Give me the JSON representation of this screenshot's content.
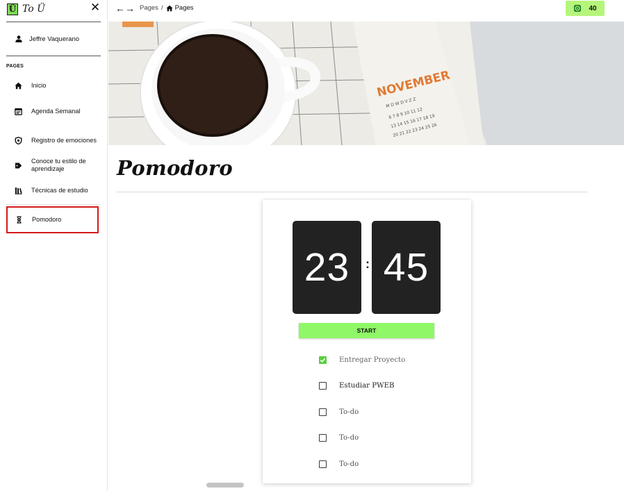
{
  "app": {
    "logo_letter": "Ü",
    "name": "To Ü",
    "close_glyph": "✕"
  },
  "sidebar": {
    "user_name": "Jeffre Vaquerano",
    "section_label": "PAGES",
    "items": [
      {
        "label": "Inicio",
        "icon": "home-icon"
      },
      {
        "label": "Agenda Semanal",
        "icon": "calendar-icon"
      },
      {
        "label": "Registro de emociones",
        "icon": "shield-icon"
      },
      {
        "label": "Conoce tu estilo de aprendizaje",
        "icon": "tag-icon"
      },
      {
        "label": "Técnicas de estudio",
        "icon": "library-icon"
      },
      {
        "label": "Pomodoro",
        "icon": "hourglass-icon",
        "active": true
      }
    ]
  },
  "topbar": {
    "back_glyph": "←",
    "forward_glyph": "→",
    "breadcrumb_parent": "Pages",
    "breadcrumb_separator": "/",
    "breadcrumb_current": "Pages",
    "points": "40"
  },
  "page": {
    "title": "Pomodoro",
    "hero_icon": "coffee-calendar-photo"
  },
  "timer": {
    "minutes": "23",
    "seconds": "45",
    "separator": ":",
    "start_label": "START"
  },
  "todos": [
    {
      "label": "Entregar Proyecto",
      "checked": true
    },
    {
      "label": "Estudiar PWEB",
      "checked": false
    },
    {
      "label": "To-do",
      "checked": false
    },
    {
      "label": "To-do",
      "checked": false
    },
    {
      "label": "To-do",
      "checked": false
    }
  ],
  "colors": {
    "accent_green": "#8ff768",
    "points_bg": "#b6f57a",
    "check_green": "#56cf3c",
    "active_outline": "#d41a1a",
    "flip_bg": "#222222"
  }
}
